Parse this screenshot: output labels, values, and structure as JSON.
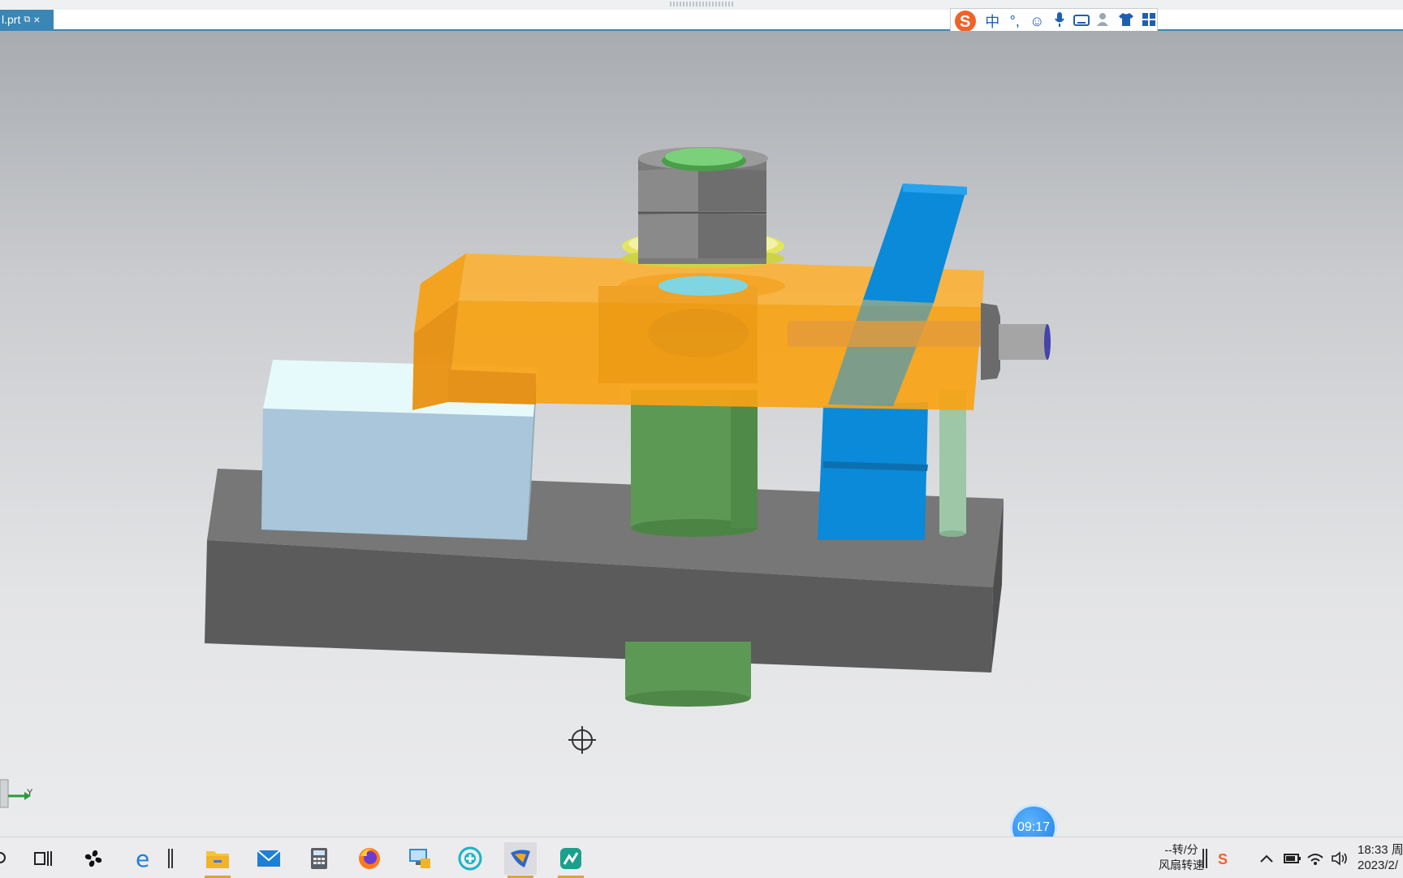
{
  "window": {
    "tab_label": "l.prt",
    "tab_close": "×"
  },
  "ime": {
    "items": [
      "中",
      "°,"
    ]
  },
  "viewport": {
    "timer": "09:17",
    "axis_label": "Y"
  },
  "taskbar": {
    "fan_speed_value": "--转/分",
    "fan_speed_label": "风扇转速",
    "time": "18:33 周",
    "date": "2023/2/"
  },
  "colors": {
    "orange": "#f8a313",
    "blue": "#0a8ad8",
    "green": "#5c9954",
    "base": "#616161",
    "lightblue": "#a9c6da",
    "accent": "#3a86b5"
  },
  "icons": [
    "sogou-s-icon",
    "emoji-icon",
    "microphone-icon",
    "keyboard-icon",
    "user-icon",
    "shirt-icon",
    "grid-icon",
    "search-icon",
    "task-view-icon",
    "fan-icon",
    "edge-icon",
    "file-explorer-icon",
    "mail-icon",
    "calculator-icon",
    "firefox-icon",
    "remote-desktop-icon",
    "plus-circle-icon",
    "nx-icon",
    "app-icon",
    "chevron-up-icon",
    "battery-icon",
    "wifi-icon",
    "volume-icon"
  ]
}
